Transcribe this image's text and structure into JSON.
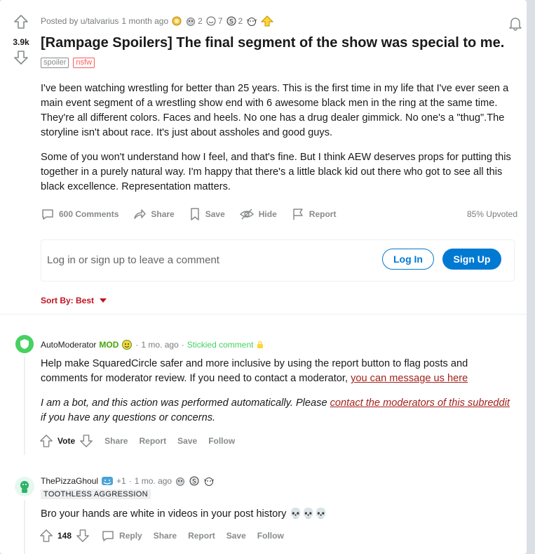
{
  "post": {
    "score": "3.9k",
    "posted_by": "Posted by u/talvarius",
    "time": "1 month ago",
    "awards": [
      {
        "icon": "gold-award-icon",
        "count": ""
      },
      {
        "icon": "wholesome-award-icon",
        "count": "2"
      },
      {
        "icon": "helpful-award-icon",
        "count": "7"
      },
      {
        "icon": "silver-coin-award-icon",
        "count": "2"
      },
      {
        "icon": "hugz-award-icon",
        "count": ""
      },
      {
        "icon": "upvote-award-icon",
        "count": ""
      }
    ],
    "title": "[Rampage Spoilers] The final segment of the show was special to me.",
    "flairs": {
      "spoiler": "spoiler",
      "nsfw": "nsfw"
    },
    "paragraphs": [
      "I've been watching wrestling for better than 25 years. This is the first time in my life that I've ever seen a main event segment of a wrestling show end with 6 awesome black men in the ring at the same time. They're all different colors. Faces and heels. No one has a drug dealer gimmick. No one's a \"thug\".The storyline isn't about race. It's just about assholes and good guys.",
      "Some of you won't understand how I feel, and that's fine. But I think AEW deserves props for putting this together in a purely natural way. I'm happy that there's a little black kid out there who got to see all this black excellence. Representation matters."
    ],
    "actions": {
      "comments": "600 Comments",
      "share": "Share",
      "save": "Save",
      "hide": "Hide",
      "report": "Report",
      "upvoted": "85% Upvoted"
    }
  },
  "login_prompt": {
    "text": "Log in or sign up to leave a comment",
    "login": "Log In",
    "signup": "Sign Up"
  },
  "sort": {
    "label": "Sort By: Best"
  },
  "comments": [
    {
      "author": "AutoModerator",
      "badge": "MOD",
      "time": "1 mo. ago",
      "sticky": "Stickied comment",
      "text_before_link": "Help make SquaredCircle safer and more inclusive by using the report button to flag posts and comments for moderator review. If you need to contact a moderator, ",
      "link": "you can message us here",
      "note_before_link": "I am a bot, and this action was performed automatically. Please ",
      "note_link": "contact the moderators of this subreddit",
      "note_after_link": " if you have any questions or concerns.",
      "actions": {
        "vote": "Vote",
        "share": "Share",
        "report": "Report",
        "save": "Save",
        "follow": "Follow"
      }
    },
    {
      "author": "ThePizzaGhoul",
      "plus": "+1",
      "time": "1 mo. ago",
      "flair": "TOOTHLESS AGGRESSION",
      "text": "Bro your hands are white in videos in your post history",
      "emoji": "💀💀💀",
      "score": "148",
      "actions": {
        "reply": "Reply",
        "share": "Share",
        "report": "Report",
        "save": "Save",
        "follow": "Follow"
      }
    }
  ]
}
